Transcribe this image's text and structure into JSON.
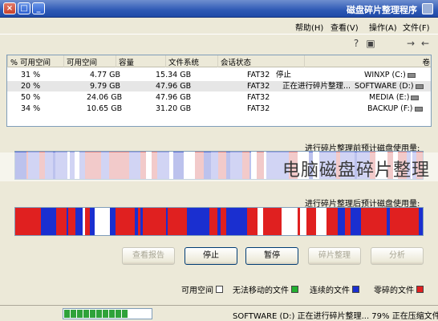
{
  "window": {
    "title": "磁盘碎片整理程序",
    "min_label": "_",
    "max_label": "□",
    "close_label": "×"
  },
  "menu": {
    "file": "文件(F)",
    "action": "操作(A)",
    "view": "查看(V)",
    "help": "帮助(H)"
  },
  "toolbar": {
    "back_icon": "arrow-left-icon",
    "forward_icon": "arrow-right-icon",
    "help_icon": "help-icon",
    "properties_icon": "properties-icon"
  },
  "table": {
    "columns": [
      "卷",
      "会话状态",
      "文件系统",
      "容量",
      "可用空间",
      "% 可用空间"
    ],
    "rows": [
      {
        "volume": "WINXP (C:)",
        "status": "停止",
        "fs": "FAT32",
        "capacity": "15.34 GB",
        "free": "4.77 GB",
        "pct": "31 %"
      },
      {
        "volume": "SOFTWARE (D:)",
        "status": "正在进行碎片整理...",
        "fs": "FAT32",
        "capacity": "47.96 GB",
        "free": "9.79 GB",
        "pct": "20 %"
      },
      {
        "volume": "MEDIA (E:)",
        "status": "",
        "fs": "FAT32",
        "capacity": "47.96 GB",
        "free": "24.06 GB",
        "pct": "50 %"
      },
      {
        "volume": "BACKUP (F:)",
        "status": "",
        "fs": "FAT32",
        "capacity": "31.20 GB",
        "free": "10.65 GB",
        "pct": "34 %"
      }
    ]
  },
  "before_label": "进行碎片整理前预计磁盘使用量:",
  "after_label": "进行碎片整理后预计磁盘使用量:",
  "watermark": "电脑磁盘碎片整理",
  "buttons": {
    "analyze": "分析",
    "defrag": "碎片整理",
    "pause": "暂停",
    "stop": "停止",
    "report": "查看报告"
  },
  "legend": {
    "fragmented": "零碎的文件",
    "contiguous": "连续的文件",
    "unmovable": "无法移动的文件",
    "free": "可用空间"
  },
  "colors": {
    "fragmented": "#e02020",
    "contiguous": "#1a2fd0",
    "unmovable": "#22b030",
    "free": "#ffffff"
  },
  "status": {
    "text": "SOFTWARE (D:) 正在进行碎片整理... 79%  正在压缩文件",
    "progress_percent": 79
  }
}
